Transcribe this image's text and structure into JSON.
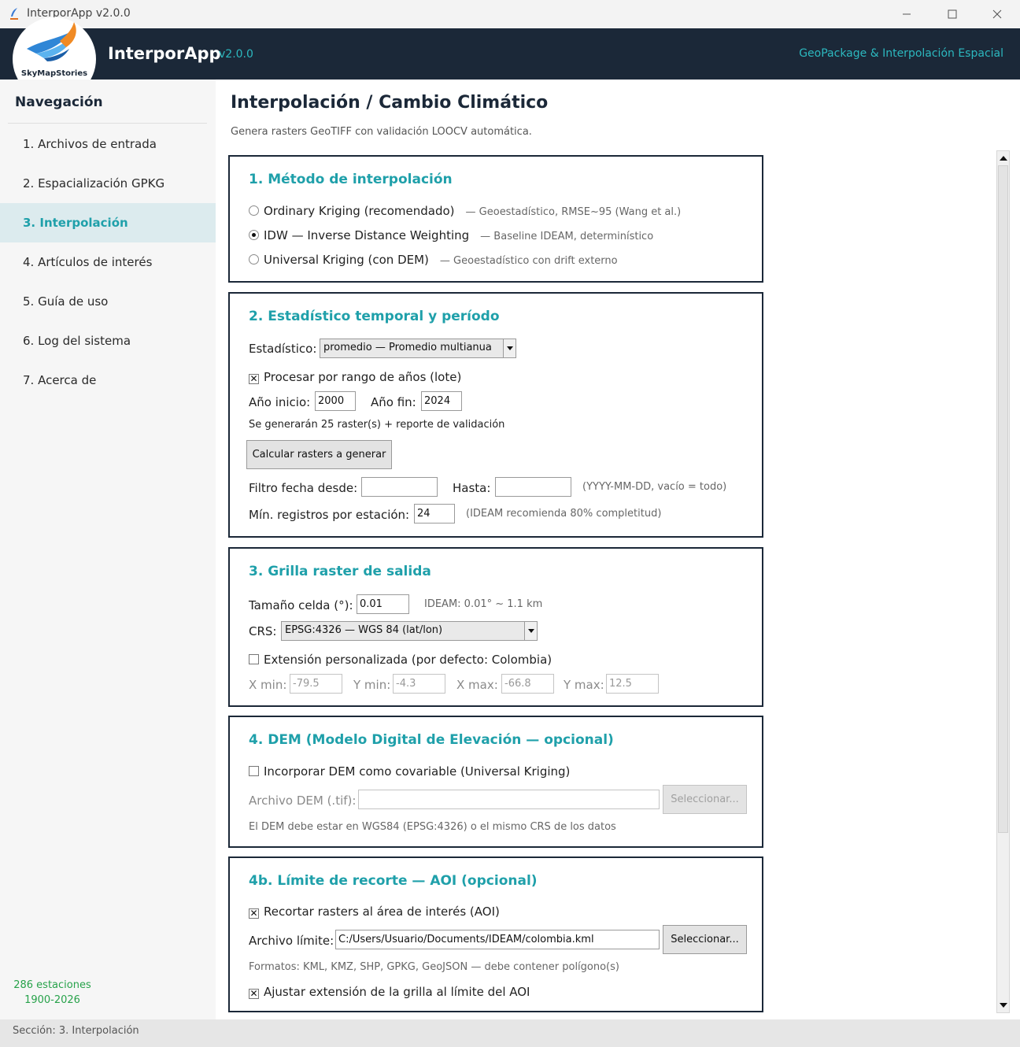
{
  "window": {
    "title": "InterporApp v2.0.0"
  },
  "header": {
    "logo_text": "SkyMapStories",
    "app_name": "InterporApp",
    "version": "v2.0.0",
    "tagline": "GeoPackage & Interpolación Espacial"
  },
  "sidebar": {
    "title": "Navegación",
    "items": [
      {
        "label": "1. Archivos de entrada"
      },
      {
        "label": "2. Espacialización GPKG"
      },
      {
        "label": "3. Interpolación"
      },
      {
        "label": "4. Artículos de interés"
      },
      {
        "label": "5. Guía de uso"
      },
      {
        "label": "6. Log del sistema"
      },
      {
        "label": "7. Acerca de"
      }
    ],
    "stations": "286 estaciones",
    "years": "1900-2026"
  },
  "page": {
    "title": "Interpolación / Cambio Climático",
    "subtitle": "Genera rasters GeoTIFF con validación LOOCV automática."
  },
  "method": {
    "title": "1. Método de interpolación",
    "options": [
      {
        "label": "Ordinary Kriging (recomendado)",
        "note": "— Geoestadístico, RMSE~95 (Wang et al.)",
        "selected": false
      },
      {
        "label": "IDW — Inverse Distance Weighting",
        "note": "— Baseline IDEAM, determinístico",
        "selected": true
      },
      {
        "label": "Universal Kriging (con DEM)",
        "note": "— Geoestadístico con drift externo",
        "selected": false
      }
    ]
  },
  "temporal": {
    "title": "2. Estadístico temporal y período",
    "stat_label": "Estadístico:",
    "stat_value": "promedio — Promedio multianua",
    "batch_label": "Procesar por rango de años (lote)",
    "batch_checked": true,
    "start_label": "Año inicio:",
    "start_value": "2000",
    "end_label": "Año fin:",
    "end_value": "2024",
    "info": "Se generarán 25 raster(s) + reporte de validación",
    "calc_button": "Calcular rasters a generar",
    "filter_from_label": "Filtro fecha desde:",
    "filter_from_value": "",
    "filter_to_label": "Hasta:",
    "filter_to_value": "",
    "filter_note": "(YYYY-MM-DD, vacío = todo)",
    "min_label": "Mín. registros por estación:",
    "min_value": "24",
    "min_note": "(IDEAM recomienda 80% completitud)"
  },
  "grid": {
    "title": "3. Grilla raster de salida",
    "cell_label": "Tamaño celda (°):",
    "cell_value": "0.01",
    "cell_note": "IDEAM: 0.01° ~ 1.1 km",
    "crs_label": "CRS:",
    "crs_value": "EPSG:4326 — WGS 84 (lat/lon)",
    "custom_label": "Extensión personalizada (por defecto: Colombia)",
    "custom_checked": false,
    "xmin_label": "X min:",
    "xmin_value": "-79.5",
    "ymin_label": "Y min:",
    "ymin_value": "-4.3",
    "xmax_label": "X max:",
    "xmax_value": "-66.8",
    "ymax_label": "Y max:",
    "ymax_value": "12.5"
  },
  "dem": {
    "title": "4. DEM (Modelo Digital de Elevación — opcional)",
    "use_label": "Incorporar DEM como covariable (Universal Kriging)",
    "use_checked": false,
    "file_label": "Archivo DEM (.tif):",
    "file_value": "",
    "select_button": "Seleccionar...",
    "note": "El DEM debe estar en WGS84 (EPSG:4326) o el mismo CRS de los datos"
  },
  "aoi": {
    "title": "4b. Límite de recorte — AOI (opcional)",
    "clip_label": "Recortar rasters al área de interés (AOI)",
    "clip_checked": true,
    "file_label": "Archivo límite:",
    "file_value": "C:/Users/Usuario/Documents/IDEAM/colombia.kml",
    "select_button": "Seleccionar...",
    "formats": "Formatos: KML, KMZ, SHP, GPKG, GeoJSON — debe contener polígono(s)",
    "adjust_label": "Ajustar extensión de la grilla al límite del AOI",
    "adjust_checked": true
  },
  "statusbar": {
    "text": "Sección: 3. Interpolación"
  },
  "colors": {
    "header_bg": "#1b2838",
    "accent": "#1fa0aa",
    "stats": "#27a24a",
    "nav_active_bg": "#dcebee"
  }
}
